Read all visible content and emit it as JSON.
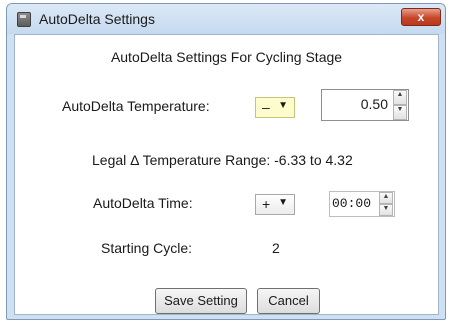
{
  "window": {
    "title": "AutoDelta Settings",
    "close_glyph": "x"
  },
  "dialog": {
    "heading": "AutoDelta Settings For Cycling Stage",
    "temperature": {
      "label": "AutoDelta Temperature:",
      "sign": "–",
      "value": "0.50"
    },
    "range_text": "Legal Δ Temperature Range: -6.33 to 4.32",
    "time": {
      "label": "AutoDelta Time:",
      "sign": "+",
      "value": "00:00"
    },
    "starting_cycle": {
      "label": "Starting Cycle:",
      "value": "2"
    },
    "buttons": {
      "save": "Save Setting",
      "cancel": "Cancel"
    }
  },
  "icons": {
    "dropdown_arrow": "▼",
    "spin_up": "▲",
    "spin_down": "▼"
  },
  "colors": {
    "accent_close": "#c8462a",
    "highlight_dropdown": "#fefbcc"
  }
}
